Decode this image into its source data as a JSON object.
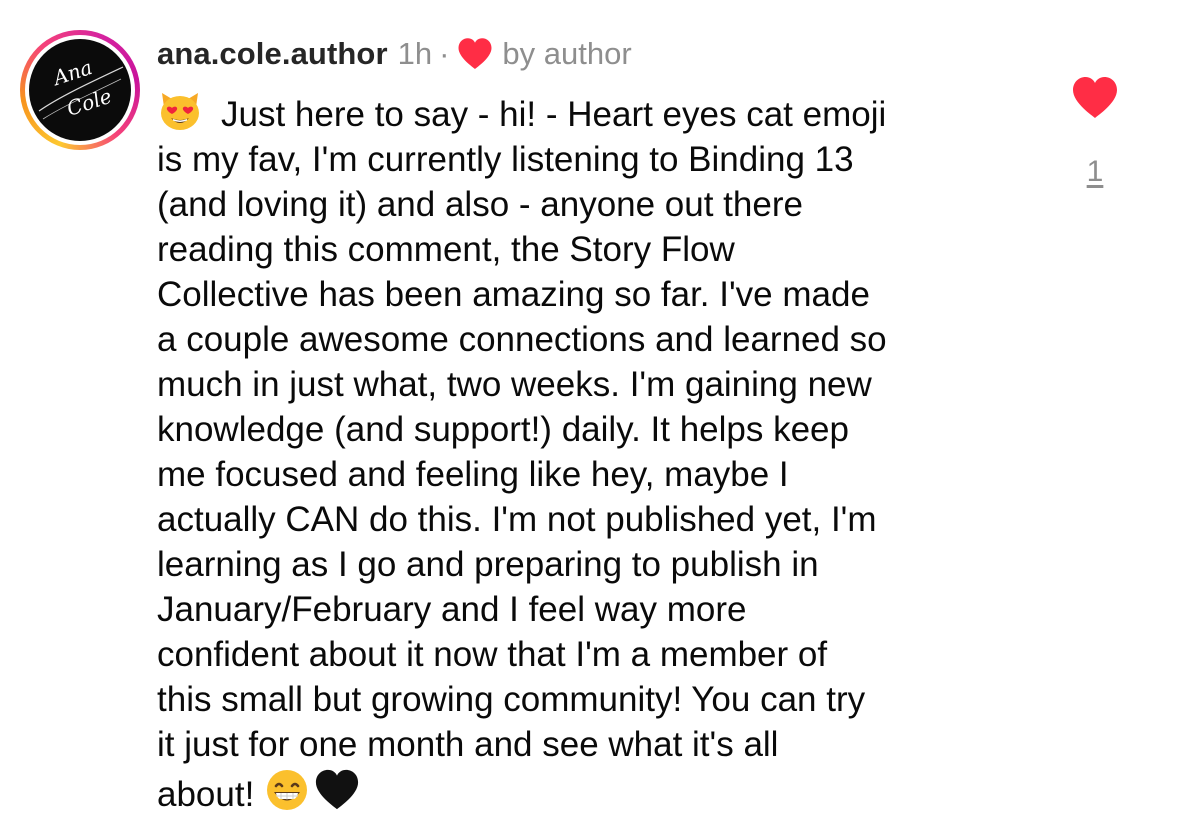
{
  "comment": {
    "username": "ana.cole.author",
    "time": "1h",
    "separator": "·",
    "liked_by_author_label": "by author",
    "avatar": {
      "icon": "script-signature-logo-icon",
      "logo_text_line1": "Ana",
      "logo_text_line2": "Cole"
    },
    "text": "Just here to say - hi! - Heart eyes cat emoji\nis my fav, I'm currently listening to Binding 13\n(and loving it) and also - anyone out there\nreading this comment, the Story Flow\nCollective has been amazing so far. I've made\na couple awesome connections and learned so\nmuch in just what, two weeks. I'm gaining new\nknowledge (and support!) daily. It helps keep\nme focused and feeling like hey, maybe I\nactually CAN do this. I'm not published yet, I'm\nlearning as I go and preparing to publish in\nJanuary/February and I feel way more\nconfident about it now that I'm a member of\nthis small but growing community! You can try\nit just for one month and see what it's all\nabout!",
    "lead_emoji": "heart-eyes-cat-emoji",
    "trail_emojis": [
      "grinning-face-emoji",
      "black-heart-emoji"
    ],
    "like_count": "1",
    "liked": true
  },
  "colors": {
    "heart_red": "#ff2d45",
    "secondary_text": "#8e8e8e",
    "username_text": "#262626",
    "ring_gradient": [
      "#fdc830",
      "#f7931e",
      "#f5427a",
      "#d6249f"
    ]
  }
}
